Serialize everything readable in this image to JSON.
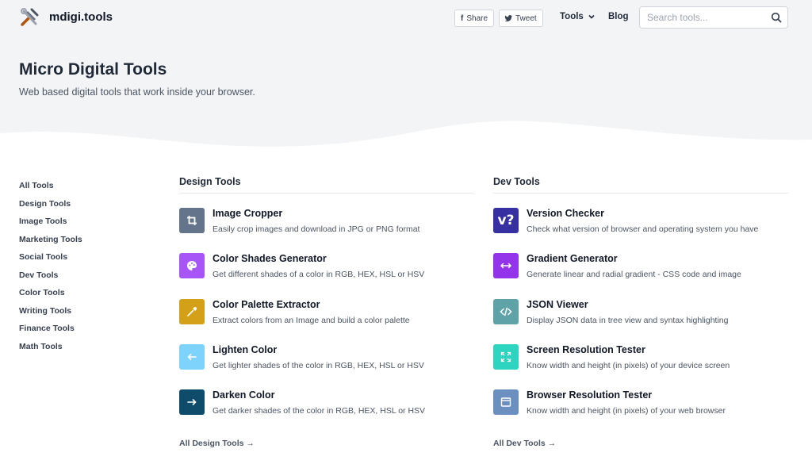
{
  "header": {
    "brand": "mdigi.tools",
    "share_label": "Share",
    "tweet_label": "Tweet",
    "nav_tools": "Tools",
    "nav_blog": "Blog",
    "search_placeholder": "Search tools..."
  },
  "hero": {
    "title": "Micro Digital Tools",
    "subtitle": "Web based digital tools that work inside your browser."
  },
  "sidebar": {
    "items": [
      "All Tools",
      "Design Tools",
      "Image Tools",
      "Marketing Tools",
      "Social Tools",
      "Dev Tools",
      "Color Tools",
      "Writing Tools",
      "Finance Tools",
      "Math Tools"
    ]
  },
  "design": {
    "heading": "Design Tools",
    "all_link": "All Design Tools →",
    "tools": [
      {
        "name": "Image Cropper",
        "desc": "Easily crop images and download in JPG or PNG format",
        "icon": "crop-icon",
        "color": "#64748b"
      },
      {
        "name": "Color Shades Generator",
        "desc": "Get different shades of a color in RGB, HEX, HSL or HSV",
        "icon": "palette-icon",
        "color": "#a855f7"
      },
      {
        "name": "Color Palette Extractor",
        "desc": "Extract colors from an Image and build a color palette",
        "icon": "eyedropper-icon",
        "color": "#d4a017"
      },
      {
        "name": "Lighten Color",
        "desc": "Get lighter shades of the color in RGB, HEX, HSL or HSV",
        "icon": "arrow-left-icon",
        "color": "#7dd3fc"
      },
      {
        "name": "Darken Color",
        "desc": "Get darker shades of the color in RGB, HEX, HSL or HSV",
        "icon": "arrow-right-icon",
        "color": "#0f4c6b"
      }
    ]
  },
  "dev": {
    "heading": "Dev Tools",
    "all_link": "All Dev Tools →",
    "tools": [
      {
        "name": "Version Checker",
        "desc": "Check what version of browser and operating system you have",
        "icon": "version-icon",
        "glyph": "v?",
        "color": "#3730a3"
      },
      {
        "name": "Gradient Generator",
        "desc": "Generate linear and radial gradient - CSS code and image",
        "icon": "gradient-icon",
        "color": "#9333ea"
      },
      {
        "name": "JSON Viewer",
        "desc": "Display JSON data in tree view and syntax highlighting",
        "icon": "code-icon",
        "color": "#5fa3a8"
      },
      {
        "name": "Screen Resolution Tester",
        "desc": "Know width and height (in pixels) of your device screen",
        "icon": "expand-icon",
        "color": "#2dd4bf"
      },
      {
        "name": "Browser Resolution Tester",
        "desc": "Know width and height (in pixels) of your web browser",
        "icon": "browser-window-icon",
        "color": "#6b8fbf"
      }
    ]
  }
}
